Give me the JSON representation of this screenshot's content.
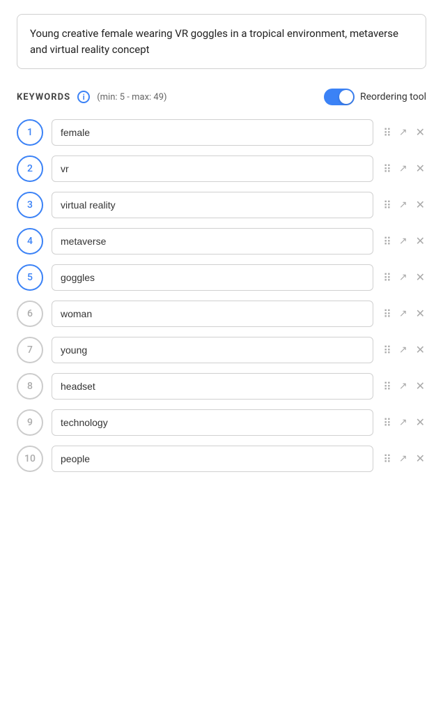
{
  "description": {
    "text": "Young creative female wearing VR goggles in a tropical environment, metaverse and virtual reality concept"
  },
  "keywords_section": {
    "label": "KEYWORDS",
    "info_label": "i",
    "range_text": "(min: 5 - max: 49)",
    "toggle_label": "Reordering tool",
    "toggle_on": true
  },
  "keywords": [
    {
      "id": 1,
      "value": "female",
      "active": true
    },
    {
      "id": 2,
      "value": "vr",
      "active": true
    },
    {
      "id": 3,
      "value": "virtual reality",
      "active": true
    },
    {
      "id": 4,
      "value": "metaverse",
      "active": true
    },
    {
      "id": 5,
      "value": "goggles",
      "active": true
    },
    {
      "id": 6,
      "value": "woman",
      "active": false
    },
    {
      "id": 7,
      "value": "young",
      "active": false
    },
    {
      "id": 8,
      "value": "headset",
      "active": false
    },
    {
      "id": 9,
      "value": "technology",
      "active": false
    },
    {
      "id": 10,
      "value": "people",
      "active": false
    }
  ]
}
